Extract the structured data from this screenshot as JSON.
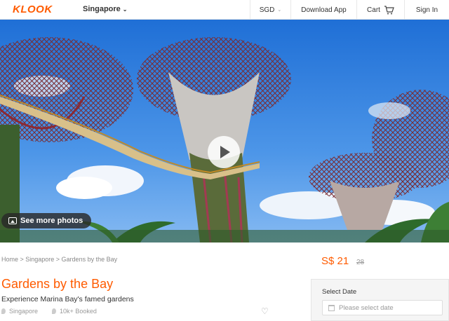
{
  "header": {
    "logo": "KLOOK",
    "city": "Singapore",
    "currency": "SGD",
    "download": "Download App",
    "cart": "Cart",
    "signin": "Sign In"
  },
  "hero": {
    "see_more": "See more photos"
  },
  "breadcrumb": "Home > Singapore > Gardens by the Bay",
  "activity": {
    "title": "Gardens by the Bay",
    "subtitle": "Experience Marina Bay's famed gardens",
    "location": "Singapore",
    "booked": "10k+ Booked"
  },
  "pricing": {
    "price": "S$ 21",
    "original": "28"
  },
  "booking": {
    "date_label": "Select Date",
    "date_placeholder": "Please select date"
  },
  "colors": {
    "brand": "#ff5b00"
  }
}
